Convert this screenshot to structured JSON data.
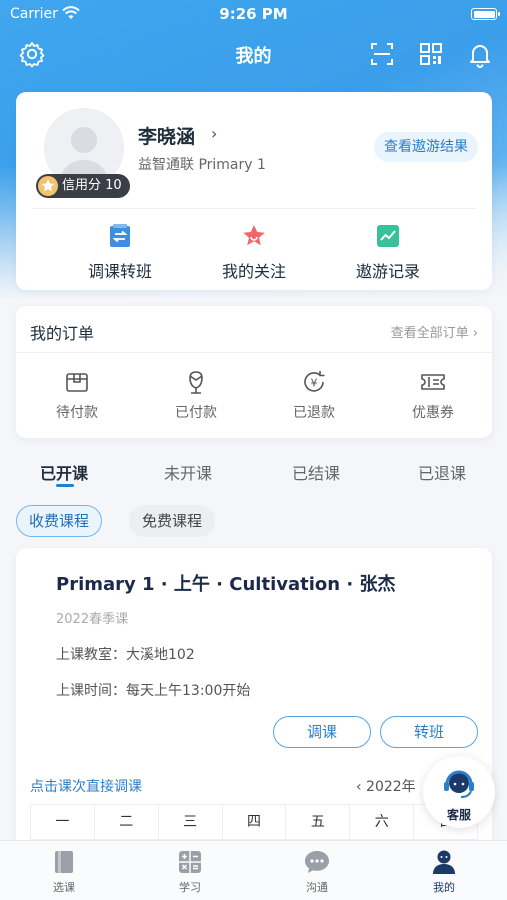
{
  "status_bar": {
    "carrier": "Carrier",
    "time": "9:26 PM"
  },
  "nav": {
    "title": "我的",
    "icons": [
      "gear-icon",
      "scan-icon",
      "qrcode-icon",
      "bell-icon"
    ]
  },
  "profile": {
    "name": "李晓涵",
    "name_chevron": "›",
    "subtitle": "益智通联   Primary 1",
    "credit_badge": "信用分 10",
    "result_button": "查看遨游结果"
  },
  "quick_actions": [
    {
      "label": "调课转班",
      "icon": "swap-class-icon"
    },
    {
      "label": "我的关注",
      "icon": "star-icon"
    },
    {
      "label": "遨游记录",
      "icon": "trend-chart-icon"
    }
  ],
  "orders": {
    "title": "我的订单",
    "view_all": "查看全部订单 ›",
    "items": [
      {
        "label": "待付款",
        "icon": "pending-payment-icon"
      },
      {
        "label": "已付款",
        "icon": "paid-icon"
      },
      {
        "label": "已退款",
        "icon": "refund-icon"
      },
      {
        "label": "优惠券",
        "icon": "coupon-icon"
      }
    ]
  },
  "course_tabs": [
    "已开课",
    "未开课",
    "已结课",
    "已退课"
  ],
  "active_course_tab": "已开课",
  "chips": [
    "收费课程",
    "免费课程"
  ],
  "course": {
    "title": "Primary 1 · 上午 · Cultivation · 张杰",
    "season": "2022春季课",
    "room": "上课教室：大溪地102",
    "time": "上课时间：每天上午13:00开始",
    "adjust_button": "调课",
    "transfer_button": "转班",
    "hint": "点击课次直接调课",
    "year_nav": "‹  2022年"
  },
  "weekdays": [
    "一",
    "二",
    "三",
    "四",
    "五",
    "六",
    "日"
  ],
  "customer_service": {
    "label": "客服"
  },
  "tabbar": [
    {
      "label": "选课",
      "icon": "book-icon"
    },
    {
      "label": "学习",
      "icon": "calculator-icon"
    },
    {
      "label": "沟通",
      "icon": "chat-icon"
    },
    {
      "label": "我的",
      "icon": "person-icon"
    }
  ],
  "active_tab": "我的",
  "colors": {
    "primary": "#3b9eea",
    "accent_text": "#2b7fc9",
    "dark_text": "#1b2a4a"
  }
}
